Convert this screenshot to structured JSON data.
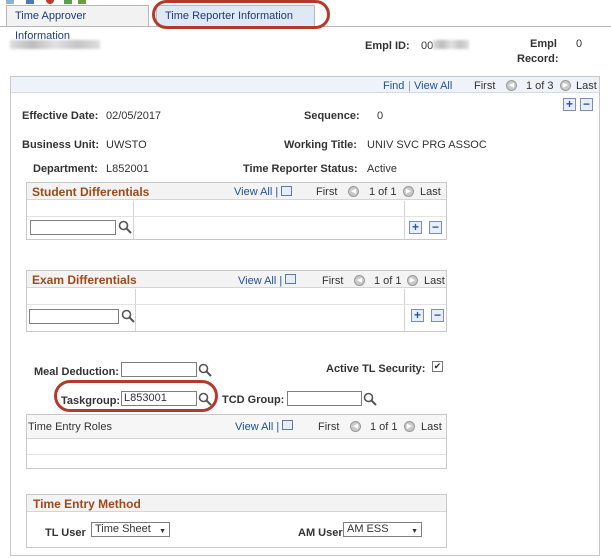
{
  "toolbar": {
    "icons": [
      "toolbar-icon-1",
      "toolbar-icon-2",
      "toolbar-icon-3",
      "toolbar-icon-4",
      "toolbar-icon-5"
    ]
  },
  "tabs": [
    {
      "label": "Time Approver Information"
    },
    {
      "label": "Time Reporter Information"
    }
  ],
  "header": {
    "empl_id_label": "Empl ID:",
    "empl_id_value": "00",
    "empl_record_label_1": "Empl",
    "empl_record_label_2": "Record:",
    "empl_record_value": "0"
  },
  "nav": {
    "find": "Find",
    "sep": "|",
    "view_all": "View All",
    "first": "First",
    "count": "1 of 3",
    "last": "Last"
  },
  "fields": {
    "effective_date_label": "Effective Date:",
    "effective_date_value": "02/05/2017",
    "sequence_label": "Sequence:",
    "sequence_value": "0",
    "business_unit_label": "Business Unit:",
    "business_unit_value": "UWSTO",
    "working_title_label": "Working Title:",
    "working_title_value": "UNIV SVC PRG ASSOC",
    "department_label": "Department:",
    "department_value": "L852001",
    "status_label": "Time Reporter Status:",
    "status_value": "Active"
  },
  "student_diff": {
    "title": "Student Differentials",
    "view_all": "View All |",
    "first": "First",
    "count": "1 of 1",
    "last": "Last"
  },
  "exam_diff": {
    "title": "Exam Differentials",
    "view_all": "View All |",
    "first": "First",
    "count": "1 of 1",
    "last": "Last"
  },
  "misc": {
    "meal_label": "Meal Deduction:",
    "active_tl_label": "Active TL Security:",
    "active_tl_checked": true,
    "taskgroup_label": "Taskgroup:",
    "taskgroup_value": "L853001",
    "tcd_label": "TCD Group:"
  },
  "roles": {
    "title": "Time Entry Roles",
    "view_all": "View All |",
    "first": "First",
    "count": "1 of 1",
    "last": "Last"
  },
  "method": {
    "title": "Time Entry Method",
    "tl_user_label": "TL User",
    "tl_user_value": "Time Sheet",
    "am_user_label": "AM User",
    "am_user_value": "AM ESS"
  },
  "icons": {
    "plus": "+",
    "minus": "−",
    "lookup": "lookup-icon",
    "prev": "◀",
    "next": "▶",
    "check": "✔",
    "caret": "▼"
  }
}
